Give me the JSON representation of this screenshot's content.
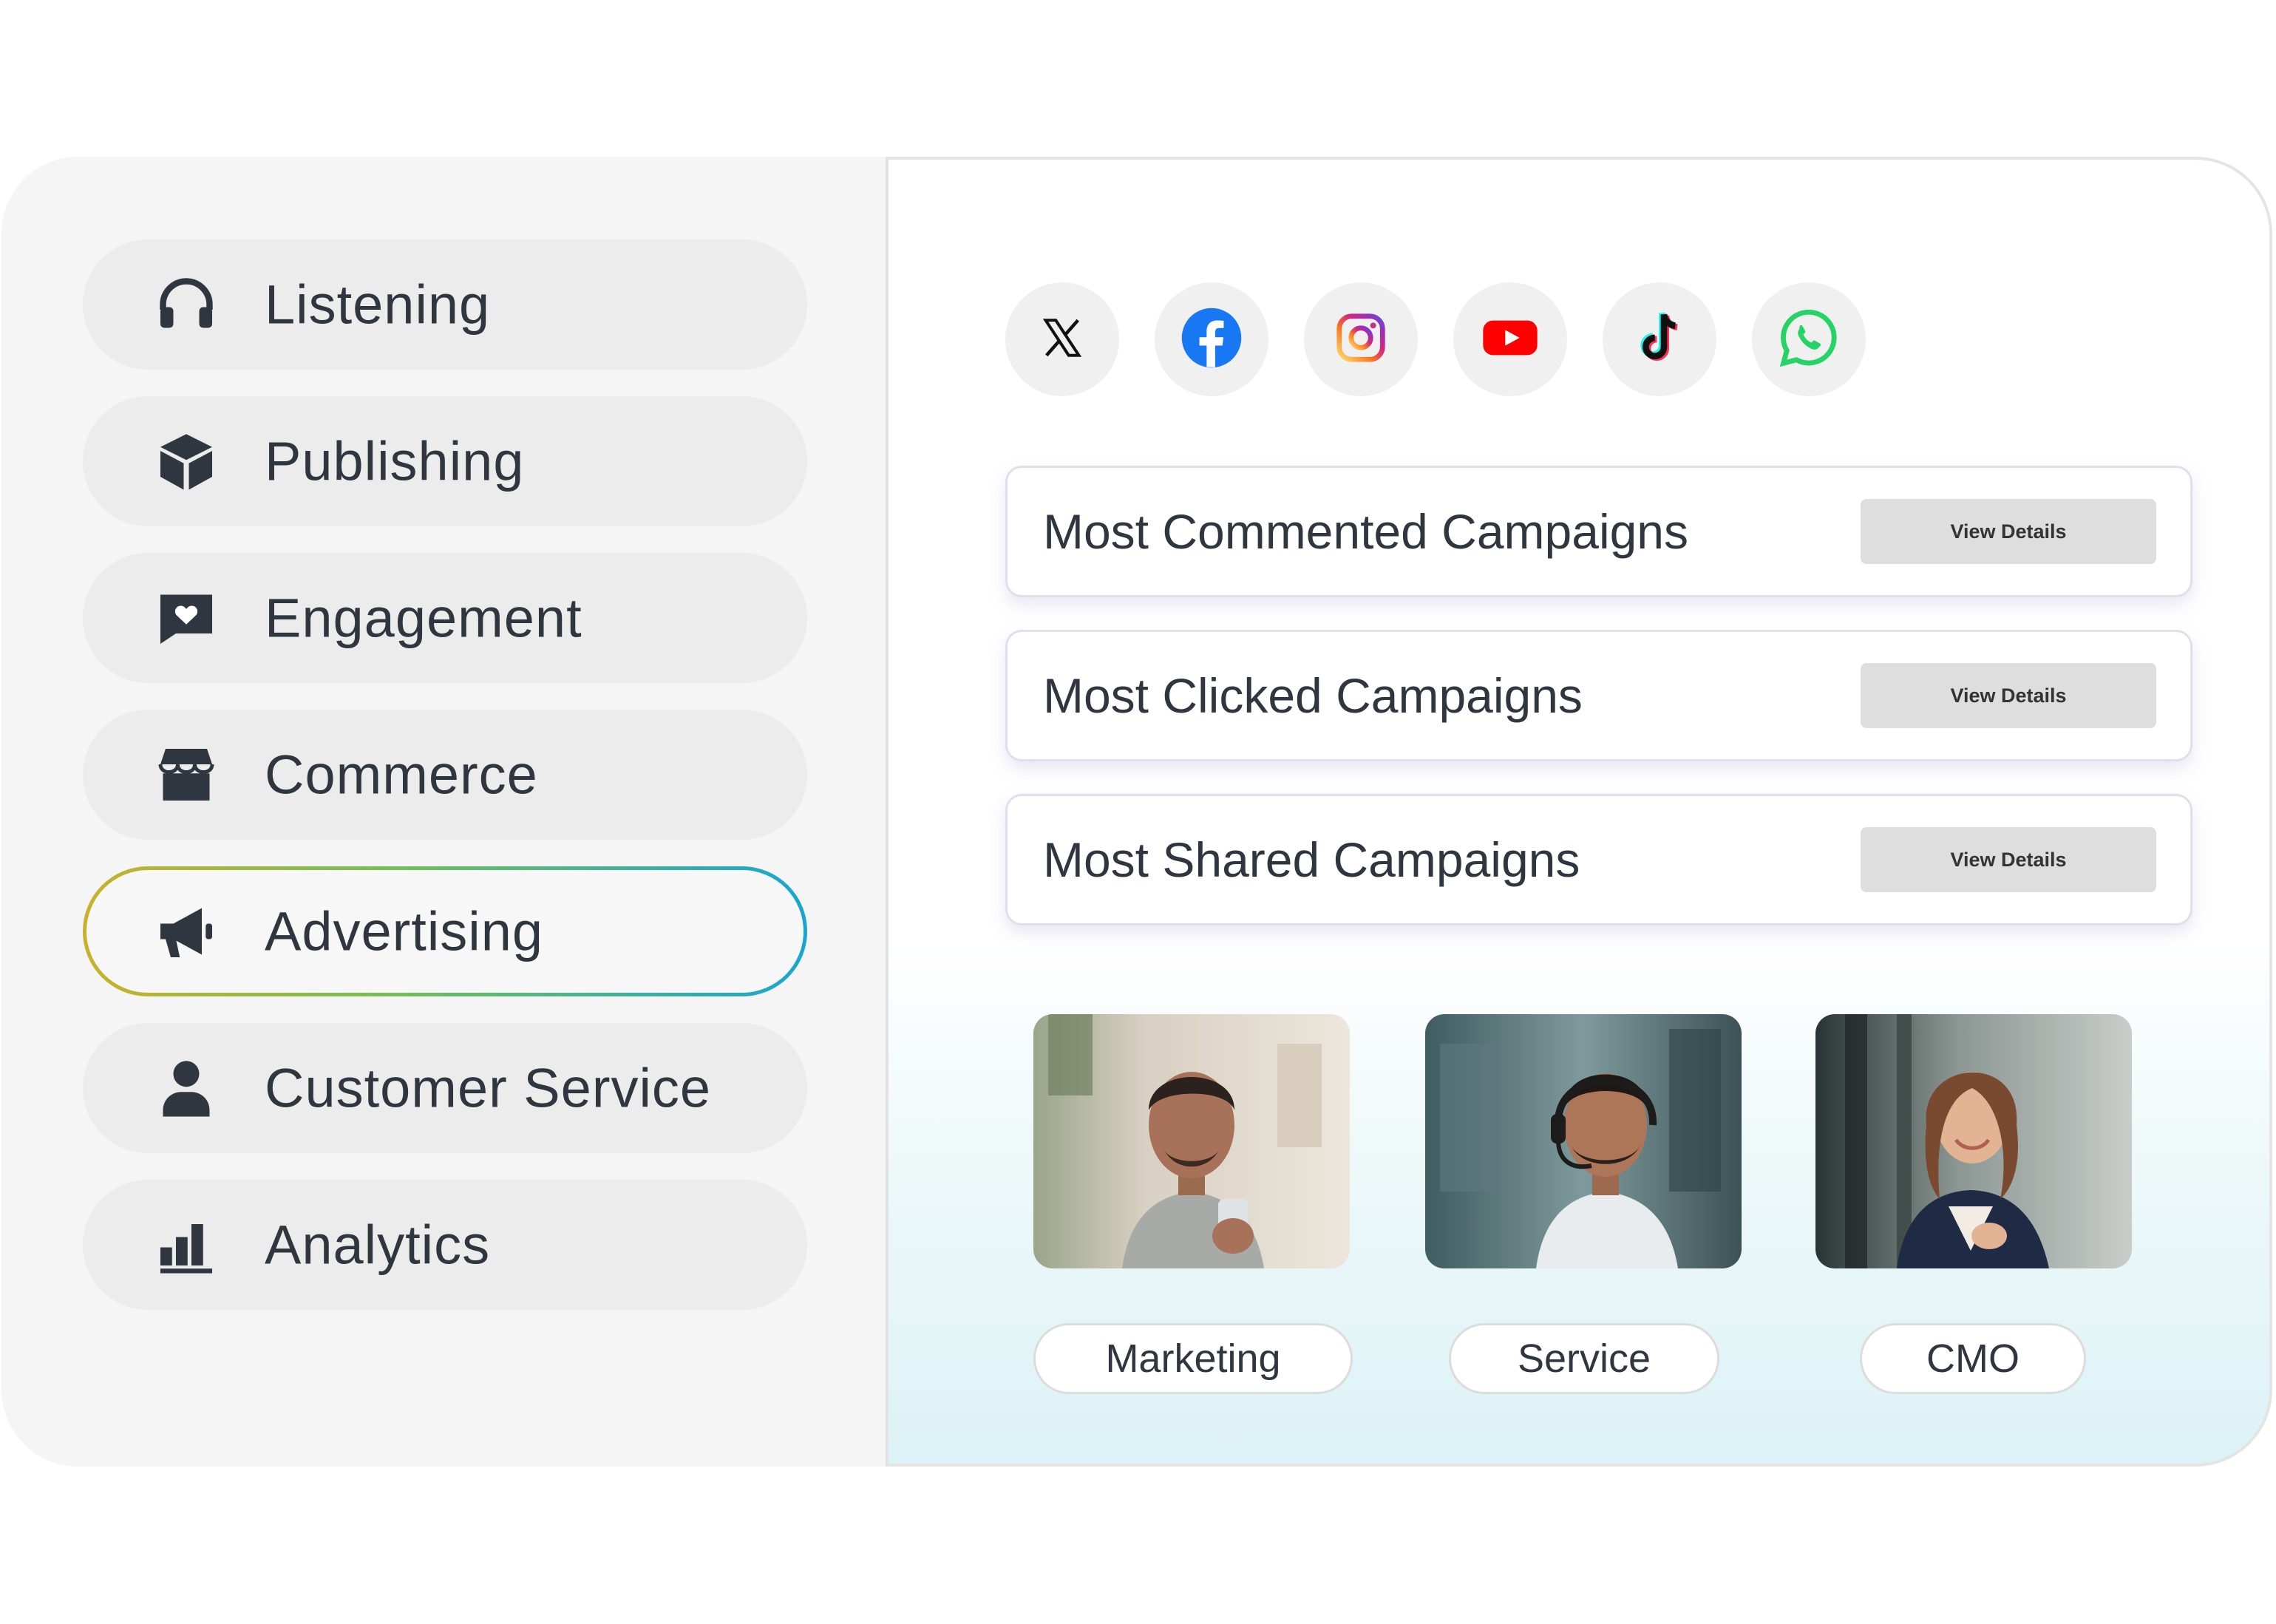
{
  "sidebar": {
    "items": [
      {
        "label": "Listening",
        "icon": "headphones-icon"
      },
      {
        "label": "Publishing",
        "icon": "cube-icon"
      },
      {
        "label": "Engagement",
        "icon": "heart-message-icon"
      },
      {
        "label": "Commerce",
        "icon": "storefront-icon"
      },
      {
        "label": "Advertising",
        "icon": "megaphone-icon",
        "active": true
      },
      {
        "label": "Customer Service",
        "icon": "person-icon"
      },
      {
        "label": "Analytics",
        "icon": "bar-chart-icon"
      }
    ]
  },
  "social_networks": [
    "X",
    "Facebook",
    "Instagram",
    "YouTube",
    "TikTok",
    "WhatsApp"
  ],
  "campaigns": [
    {
      "title": "Most Commented Campaigns",
      "button": "View Details"
    },
    {
      "title": "Most Clicked Campaigns",
      "button": "View Details"
    },
    {
      "title": "Most Shared Campaigns",
      "button": "View Details"
    }
  ],
  "teams": [
    {
      "label": "Marketing"
    },
    {
      "label": "Service"
    },
    {
      "label": "CMO"
    }
  ],
  "colors": {
    "active_gradient": [
      "#c8b22a",
      "#6fbf5a",
      "#18a6cf"
    ],
    "text": "#2f3640",
    "facebook": "#1877f2",
    "youtube": "#ff0000",
    "whatsapp": "#25d366"
  }
}
